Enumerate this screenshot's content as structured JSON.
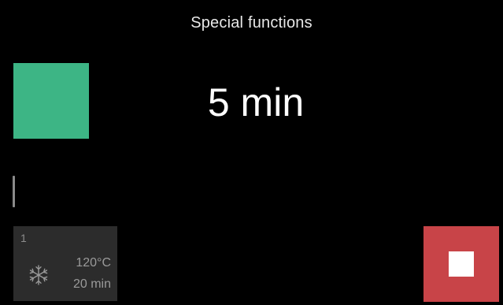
{
  "header": {
    "title": "Special functions"
  },
  "main": {
    "time_value": "5 min",
    "accent_color": "#3db585"
  },
  "program": {
    "number": "1",
    "icon": "snowflake-icon",
    "temperature": "120°C",
    "duration": "20 min"
  },
  "controls": {
    "stop_icon": "stop-icon",
    "stop_color": "#c84448"
  }
}
